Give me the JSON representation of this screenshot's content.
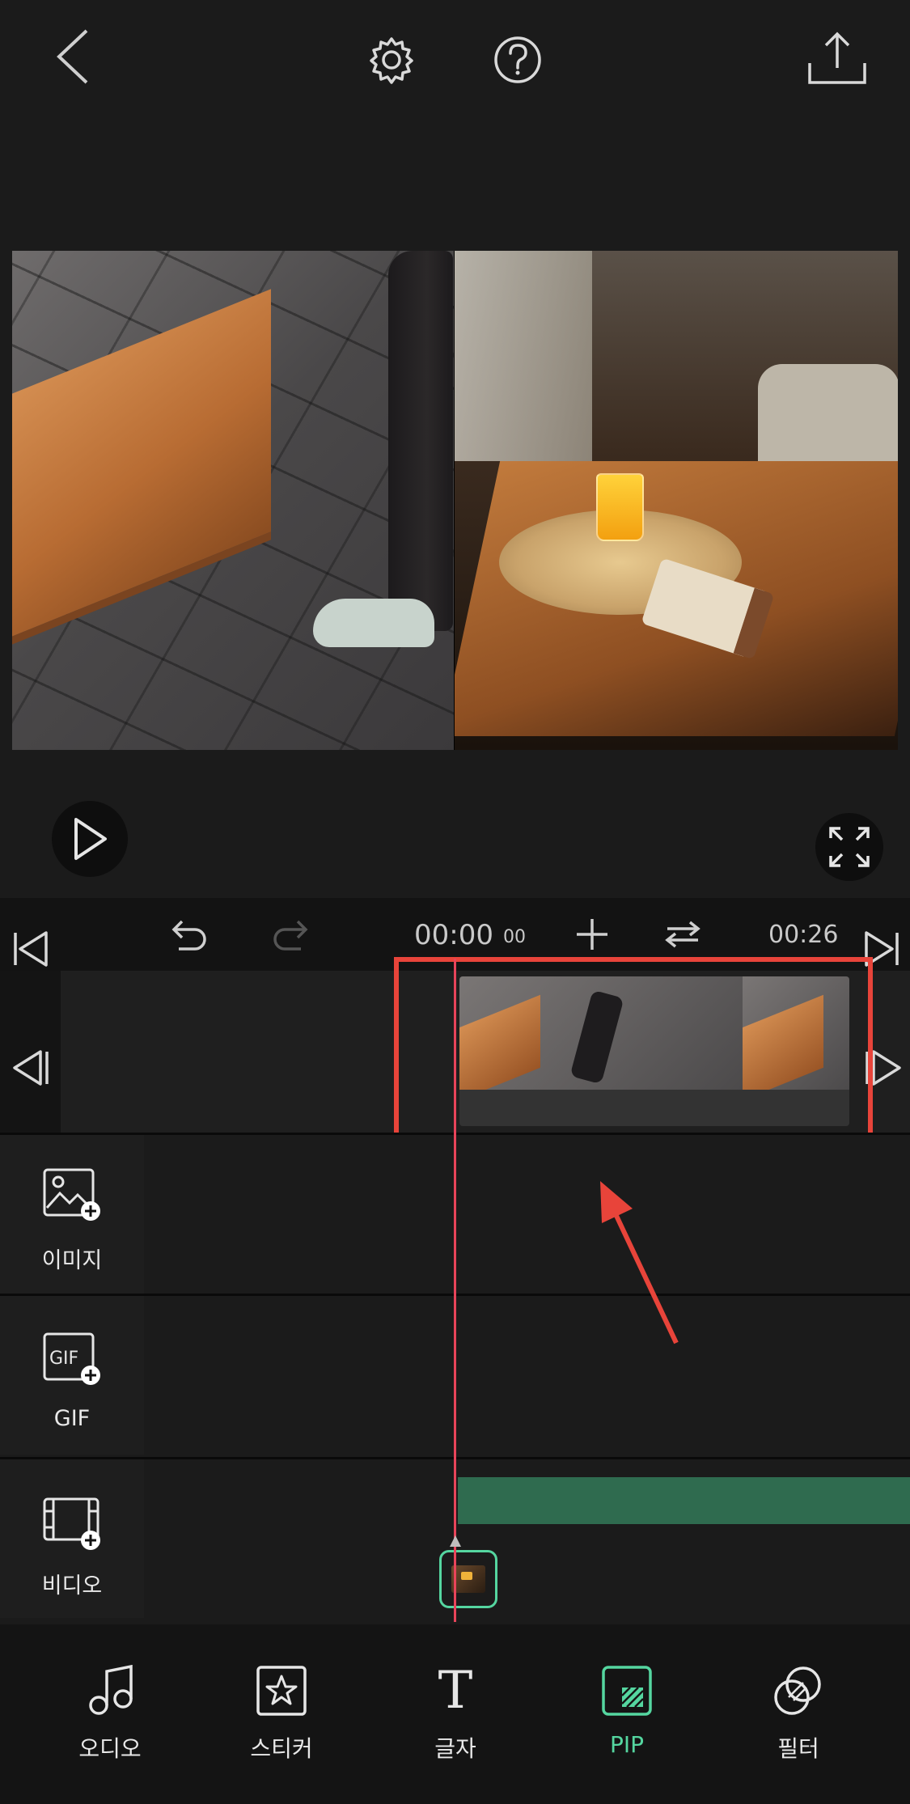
{
  "header": {
    "back_icon": "chevron-left-icon",
    "settings_icon": "gear-icon",
    "help_icon": "question-circle-icon",
    "export_icon": "share-upload-icon"
  },
  "player": {
    "play_icon": "play-icon",
    "fullscreen_icon": "expand-icon"
  },
  "timeline": {
    "current_time": "00:00",
    "current_frames": "00",
    "total_time": "00:26",
    "undo_icon": "undo-icon",
    "redo_icon": "redo-icon",
    "add_icon": "plus-icon",
    "swap_icon": "swap-arrows-icon"
  },
  "layers": [
    {
      "label": "이미지",
      "icon": "image-add-icon"
    },
    {
      "label": "GIF",
      "icon": "gif-add-icon",
      "icon_text": "GIF"
    },
    {
      "label": "비디오",
      "icon": "video-add-icon"
    }
  ],
  "toolbar": [
    {
      "label": "오디오",
      "icon": "music-note-icon"
    },
    {
      "label": "스티커",
      "icon": "sticker-star-icon"
    },
    {
      "label": "글자",
      "icon": "text-icon",
      "glyph": "T"
    },
    {
      "label": "PIP",
      "icon": "pip-icon",
      "active": true
    },
    {
      "label": "필터",
      "icon": "filter-circles-icon"
    }
  ],
  "colors": {
    "accent": "#55d6a0",
    "playhead": "#e8445a",
    "highlight": "#e8443a",
    "pip_track": "#2f6b4f"
  }
}
